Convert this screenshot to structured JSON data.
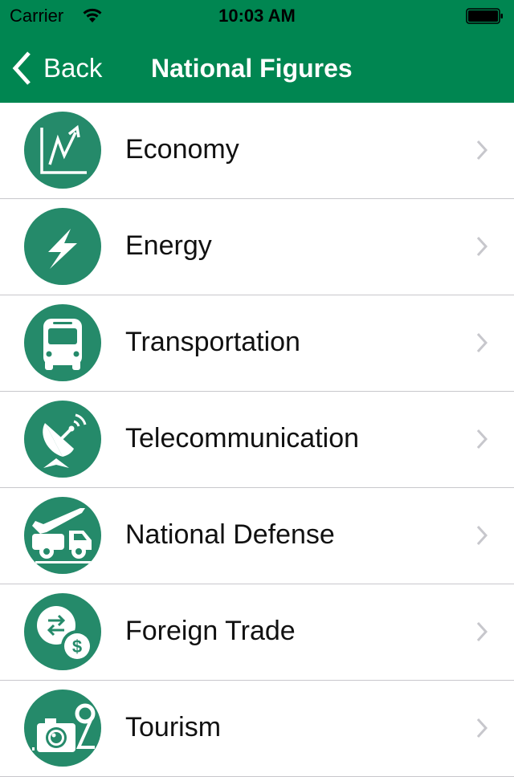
{
  "status_bar": {
    "carrier": "Carrier",
    "time": "10:03 AM"
  },
  "nav": {
    "back_label": "Back",
    "title": "National Figures"
  },
  "colors": {
    "header": "#008651",
    "icon_bg": "#258a6a",
    "chevron": "#c7c7cc"
  },
  "items": [
    {
      "label": "Economy",
      "icon": "chart-up-icon"
    },
    {
      "label": "Energy",
      "icon": "lightning-icon"
    },
    {
      "label": "Transportation",
      "icon": "bus-icon"
    },
    {
      "label": "Telecommunication",
      "icon": "satellite-dish-icon"
    },
    {
      "label": "National Defense",
      "icon": "missile-truck-icon"
    },
    {
      "label": "Foreign Trade",
      "icon": "exchange-dollar-icon"
    },
    {
      "label": "Tourism",
      "icon": "camera-pin-icon"
    }
  ]
}
